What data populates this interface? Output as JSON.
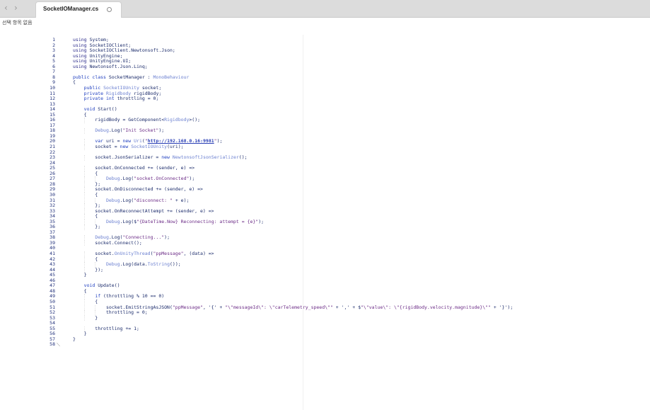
{
  "tabbar": {
    "back_icon": "‹",
    "forward_icon": "›",
    "tab_title": "SocketIOManager.cs"
  },
  "breadcrumb": "선택 항목 없음",
  "editor": {
    "first_line": 1,
    "lines": [
      "using System;",
      "using SocketIOClient;",
      "using SocketIOClient.Newtonsoft.Json;",
      "using UnityEngine;",
      "using UnityEngine.UI;",
      "using Newtonsoft.Json.Linq;",
      "",
      "public class SocketManager : MonoBehaviour",
      "{",
      "    public SocketIOUnity socket;",
      "    private Rigidbody rigidBody;",
      "    private int throttling = 0;",
      "",
      "    void Start()",
      "    {",
      "        rigidBody = GetComponent<Rigidbody>();",
      "",
      "        Debug.Log(\"Init Socket\");",
      "",
      "        var uri = new Uri(\"http://192.168.0.16:9981\");",
      "        socket = new SocketIOUnity(uri);",
      "",
      "        socket.JsonSerializer = new NewtonsoftJsonSerializer();",
      "",
      "        socket.OnConnected += (sender, e) =>",
      "        {",
      "            Debug.Log(\"socket.OnConnected\");",
      "        };",
      "        socket.OnDisconnected += (sender, e) =>",
      "        {",
      "            Debug.Log(\"disconnect: \" + e);",
      "        };",
      "        socket.OnReconnectAttempt += (sender, e) =>",
      "        {",
      "            Debug.Log($\"{DateTime.Now} Reconnecting: attempt = {e}\");",
      "        };",
      "",
      "        Debug.Log(\"Connecting...\");",
      "        socket.Connect();",
      "",
      "        socket.OnUnityThread(\"ppMessage\", (data) =>",
      "        {",
      "            Debug.Log(data.ToString());",
      "        });",
      "    }",
      "",
      "    void Update()",
      "    {",
      "        if (throttling % 10 == 0)",
      "        {",
      "            socket.EmitStringAsJSON(\"ppMessage\", '{' + \"\\\"messageId\\\": \\\"carTelemetry_speed\\\"\" + ',' + $\"\\\"value\\\": \\\"{rigidBody.velocity.magnitude}\\\"\" + '}');",
      "            throttling = 0;",
      "        }",
      "",
      "        throttling += 1;",
      "    }",
      "}",
      ""
    ]
  },
  "colors": {
    "keyword": "#1d3dbf",
    "type": "#6a7fd0",
    "string": "#6b2b86",
    "line_number": "#1f2f7a",
    "tabbar_bg": "#dcdcdc"
  }
}
